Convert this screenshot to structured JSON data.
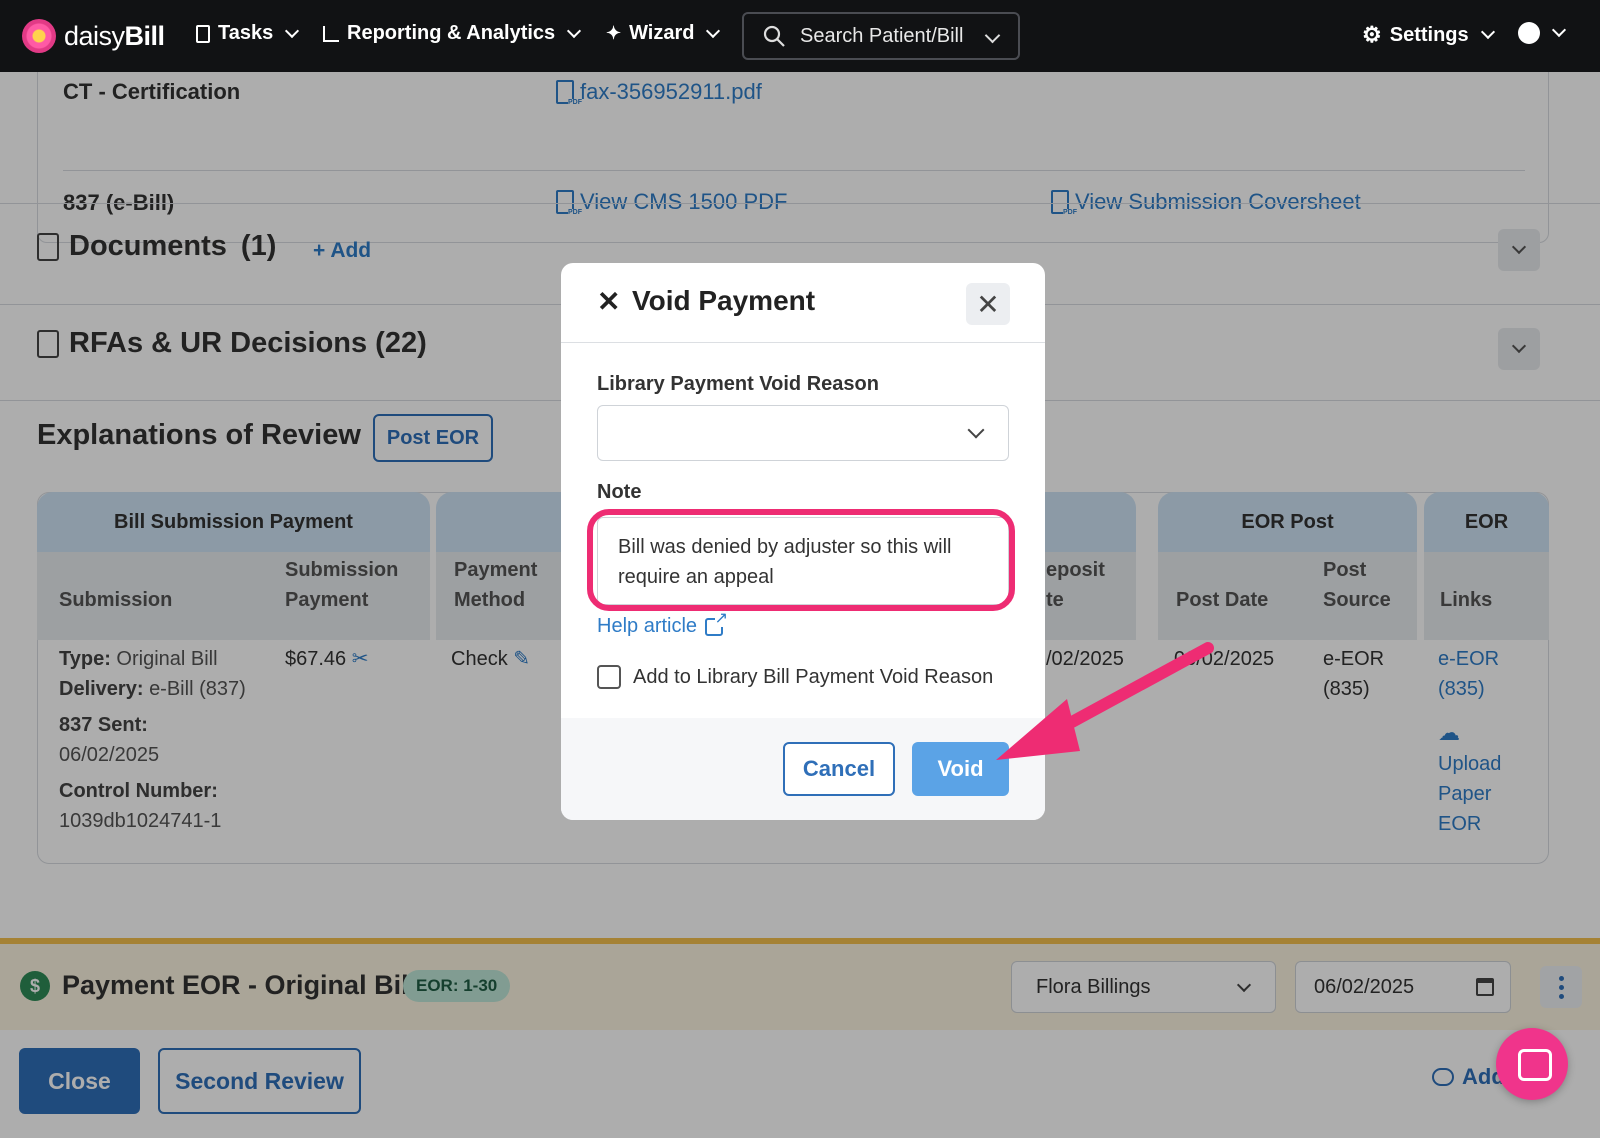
{
  "nav": {
    "logo_light": "daisy",
    "logo_bold": "Bill",
    "tasks": "Tasks",
    "reporting": "Reporting & Analytics",
    "wizard": "Wizard",
    "search_placeholder": "Search Patient/Bill",
    "settings": "Settings"
  },
  "certification": {
    "row1_label": "CT - Certification",
    "row1_link": "fax-356952911.pdf",
    "row2_label": "837 (e-Bill)",
    "row2_link1": "View CMS 1500 PDF",
    "row2_link2": "View Submission Coversheet"
  },
  "documents": {
    "title": "Documents",
    "count": "(1)",
    "add_label": "+ Add"
  },
  "rfas": {
    "title": "RFAs & UR Decisions (22)"
  },
  "eor": {
    "title": "Explanations of Review",
    "post_button": "Post EOR",
    "groups": {
      "bill_submission_payment": "Bill Submission Payment",
      "eor_post": "EOR Post",
      "eor": "EOR"
    },
    "columns": {
      "submission": "Submission",
      "submission_payment_1": "Submission",
      "submission_payment_2": "Payment",
      "payment_method_1": "Payment",
      "payment_method_2": "Method",
      "deposit_1": "eposit",
      "deposit_2": "te",
      "post_date": "Post Date",
      "post_source_1": "Post",
      "post_source_2": "Source",
      "links": "Links"
    },
    "row": {
      "type_label": "Type:",
      "type_value": "Original Bill",
      "delivery_label": "Delivery:",
      "delivery_value": "e-Bill (837)",
      "sent_label": "837 Sent:",
      "sent_value": "06/02/2025",
      "control_label": "Control Number:",
      "control_value": "1039db1024741-1",
      "amount": "$67.46",
      "method": "Check",
      "deposit_date": "/02/2025",
      "post_date": "06/02/2025",
      "post_source_1": "e-EOR",
      "post_source_2": "(835)",
      "link_eeor_1": "e-EOR",
      "link_eeor_2": "(835)",
      "upload_1": "Upload",
      "upload_2": "Paper",
      "upload_3": "EOR"
    }
  },
  "payment_bar": {
    "title": "Payment EOR - Original Bill",
    "badge": "EOR: 1-30",
    "assignee": "Flora Billings",
    "date": "06/02/2025"
  },
  "actions": {
    "close": "Close",
    "second_review": "Second Review",
    "add_note": "Add"
  },
  "modal": {
    "title": "Void Payment",
    "reason_label": "Library Payment Void Reason",
    "reason_value": "",
    "note_label": "Note",
    "note_value": "Bill was denied by adjuster so this will require an appeal",
    "help_link": "Help article",
    "checkbox_label": "Add to Library Bill Payment Void Reason",
    "cancel": "Cancel",
    "void": "Void"
  },
  "colors": {
    "accent": "#2f6fb8",
    "highlight": "#ee2c73",
    "nav_bg": "#111214"
  }
}
